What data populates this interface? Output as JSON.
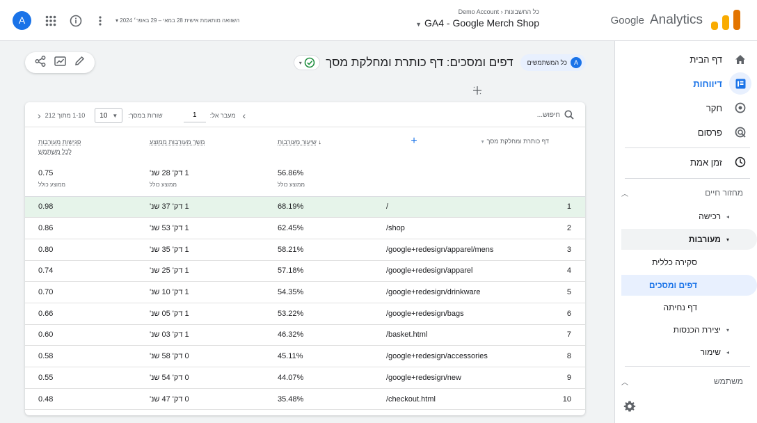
{
  "header": {
    "brand": "Analytics",
    "brand_google": "Google",
    "breadcrumb_all_accounts": "כל החשבונות",
    "breadcrumb_account": "Demo Account",
    "property_name": "GA4 - Google Merch Shop",
    "date_range": "השוואה מותאמת אישית 28 במאי – 29 באפר׳ 2024",
    "avatar_letter": "A"
  },
  "sidebar": {
    "nav": [
      {
        "label": "דף הבית",
        "icon": "home-icon"
      },
      {
        "label": "דיווחות",
        "icon": "reports-icon"
      },
      {
        "label": "חקר",
        "icon": "explore-icon"
      },
      {
        "label": "פרסום",
        "icon": "advertising-icon"
      }
    ],
    "realtime": "זמן אמת",
    "lifecycle_header": "מחזור חיים",
    "acquisition": "רכישה",
    "engagement": "מעורבות",
    "engagement_children": [
      "סקירה כללית",
      "דפים ומסכים",
      "דף נחיתה"
    ],
    "monetization": "יצירת הכנסות",
    "retention": "שימור",
    "user_header": "משתמש"
  },
  "title_bar": {
    "audience_chip": "כל המשתמשים",
    "audience_avatar": "A",
    "page_title": "דפים ומסכים: דף כותרת ומחלקת מסך"
  },
  "table": {
    "search_placeholder": "חיפוש...",
    "rows_per_page_label": "שורות במסך:",
    "rows_per_page": "10",
    "goto_label": "מעבר אל:",
    "goto_value": "1",
    "range_text": "1-10 מתוך 212",
    "dimension_header": "דף כותרת ומחלקת מסך",
    "metric_headers": [
      {
        "line1": "שיעור מעורבות",
        "line2": ""
      },
      {
        "line1": "משך מעורבות ממוצע",
        "line2": ""
      },
      {
        "line1": "פגישות מעורבות",
        "line2": "לכל משתמש"
      }
    ],
    "totals": {
      "engagement_rate": "56.86%",
      "avg_engagement_time": "1 דק' 28 שנ'",
      "engaged_sessions_per_user": "0.75",
      "avg_label": "ממוצע כולל"
    },
    "rows": [
      {
        "n": "1",
        "page": "/",
        "rate": "68.19%",
        "time": "1 דק' 37 שנ'",
        "sessions": "0.98"
      },
      {
        "n": "2",
        "page": "/shop",
        "rate": "62.45%",
        "time": "1 דק' 53 שנ'",
        "sessions": "0.86"
      },
      {
        "n": "3",
        "page": "/google+redesign/apparel/mens",
        "rate": "58.21%",
        "time": "1 דק' 35 שנ'",
        "sessions": "0.80"
      },
      {
        "n": "4",
        "page": "/google+redesign/apparel",
        "rate": "57.18%",
        "time": "1 דק' 25 שנ'",
        "sessions": "0.74"
      },
      {
        "n": "5",
        "page": "/google+redesign/drinkware",
        "rate": "54.35%",
        "time": "1 דק' 10 שנ'",
        "sessions": "0.70"
      },
      {
        "n": "6",
        "page": "/google+redesign/bags",
        "rate": "53.22%",
        "time": "1 דק' 05 שנ'",
        "sessions": "0.66"
      },
      {
        "n": "7",
        "page": "/basket.html",
        "rate": "46.32%",
        "time": "1 דק' 03 שנ'",
        "sessions": "0.60"
      },
      {
        "n": "8",
        "page": "/google+redesign/accessories",
        "rate": "45.11%",
        "time": "0 דק' 58 שנ'",
        "sessions": "0.58"
      },
      {
        "n": "9",
        "page": "/google+redesign/new",
        "rate": "44.07%",
        "time": "0 דק' 54 שנ'",
        "sessions": "0.55"
      },
      {
        "n": "10",
        "page": "/checkout.html",
        "rate": "35.48%",
        "time": "0 דק' 47 שנ'",
        "sessions": "0.48"
      }
    ]
  },
  "colors": {
    "accent": "#1a73e8",
    "highlight_row": "#e6f4ea",
    "selected_nav": "#e8f0fe"
  }
}
